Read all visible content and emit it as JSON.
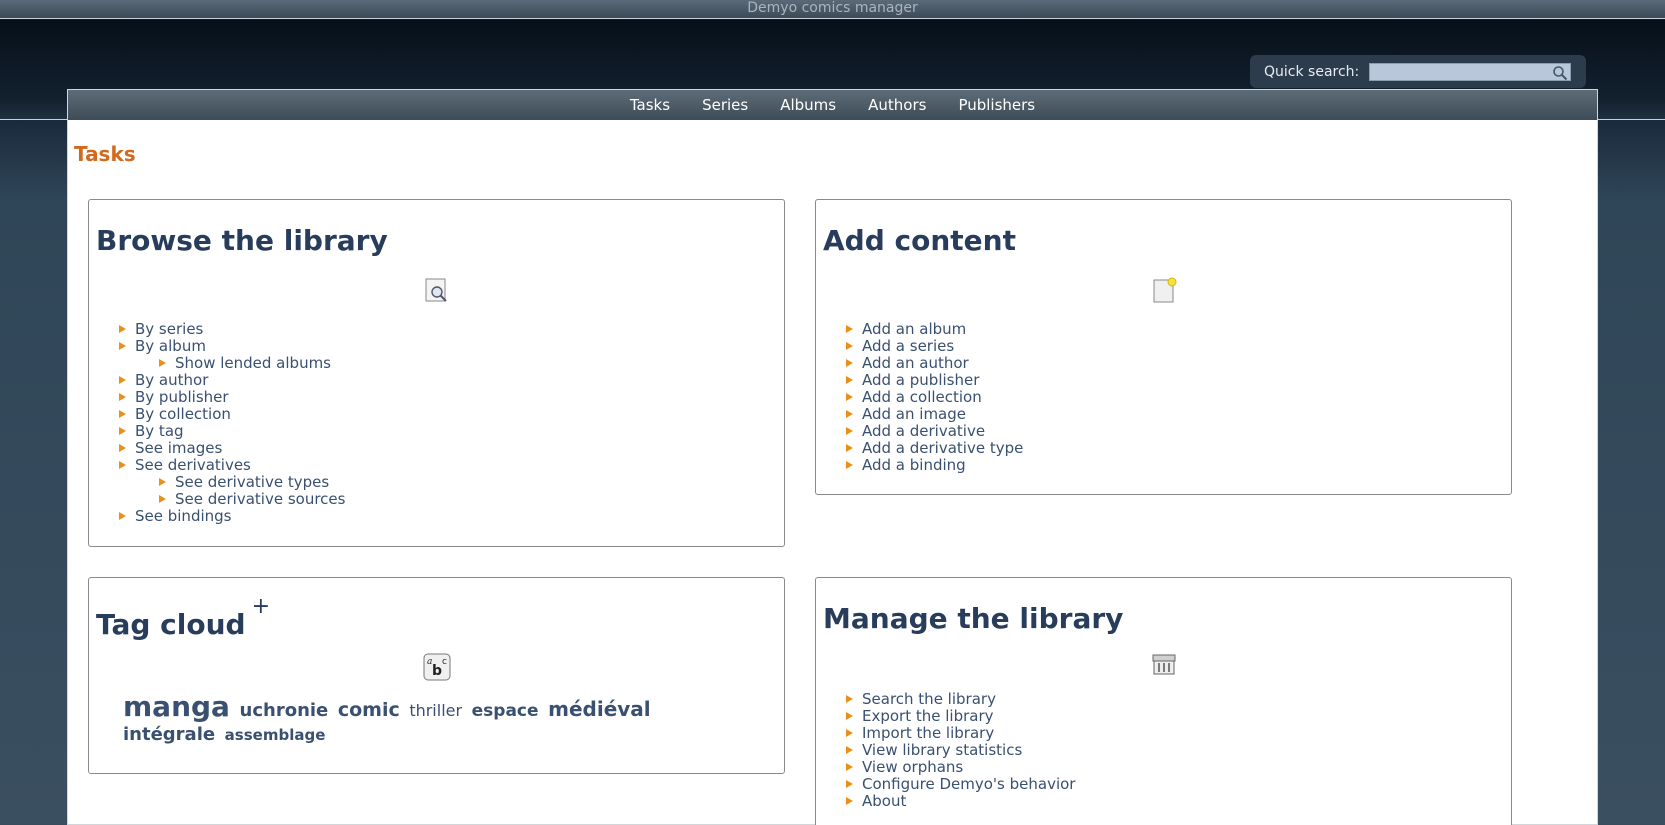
{
  "window": {
    "title": "Demyo comics manager"
  },
  "search": {
    "label": "Quick search:",
    "value": "",
    "placeholder": ""
  },
  "nav": {
    "items": [
      "Tasks",
      "Series",
      "Albums",
      "Authors",
      "Publishers"
    ]
  },
  "page": {
    "title": "Tasks"
  },
  "browse": {
    "title": "Browse the library",
    "icon": "magnifier-document-icon",
    "items": [
      {
        "label": "By series",
        "level": 0
      },
      {
        "label": "By album",
        "level": 0
      },
      {
        "label": "Show lended albums",
        "level": 1
      },
      {
        "label": "By author",
        "level": 0
      },
      {
        "label": "By publisher",
        "level": 0
      },
      {
        "label": "By collection",
        "level": 0
      },
      {
        "label": "By tag",
        "level": 0
      },
      {
        "label": "See images",
        "level": 0
      },
      {
        "label": "See derivatives",
        "level": 0
      },
      {
        "label": "See derivative types",
        "level": 1
      },
      {
        "label": "See derivative sources",
        "level": 1
      },
      {
        "label": "See bindings",
        "level": 0
      }
    ]
  },
  "add": {
    "title": "Add content",
    "icon": "new-document-icon",
    "items": [
      "Add an album",
      "Add a series",
      "Add an author",
      "Add a publisher",
      "Add a collection",
      "Add an image",
      "Add a derivative",
      "Add a derivative type",
      "Add a binding"
    ]
  },
  "tags": {
    "title": "Tag cloud",
    "plus": "+",
    "icon": "abc-text-icon",
    "items": [
      {
        "label": "manga",
        "size": 3
      },
      {
        "label": "uchronie",
        "size": 1.6
      },
      {
        "label": "comic",
        "size": 1.8
      },
      {
        "label": "thriller",
        "size": 1.4
      },
      {
        "label": "espace",
        "size": 1.5
      },
      {
        "label": "médiéval",
        "size": 1.9
      },
      {
        "label": "intégrale",
        "size": 1.6
      },
      {
        "label": "assemblage",
        "size": 1.3
      }
    ]
  },
  "manage": {
    "title": "Manage the library",
    "icon": "cabinet-icon",
    "items": [
      "Search the library",
      "Export the library",
      "Import the library",
      "View library statistics",
      "View orphans",
      "Configure Demyo's behavior",
      "About"
    ]
  },
  "colors": {
    "accent": "#d2691e",
    "heading": "#283c5c",
    "link": "#3a5070",
    "bullet": "#e8901a"
  }
}
